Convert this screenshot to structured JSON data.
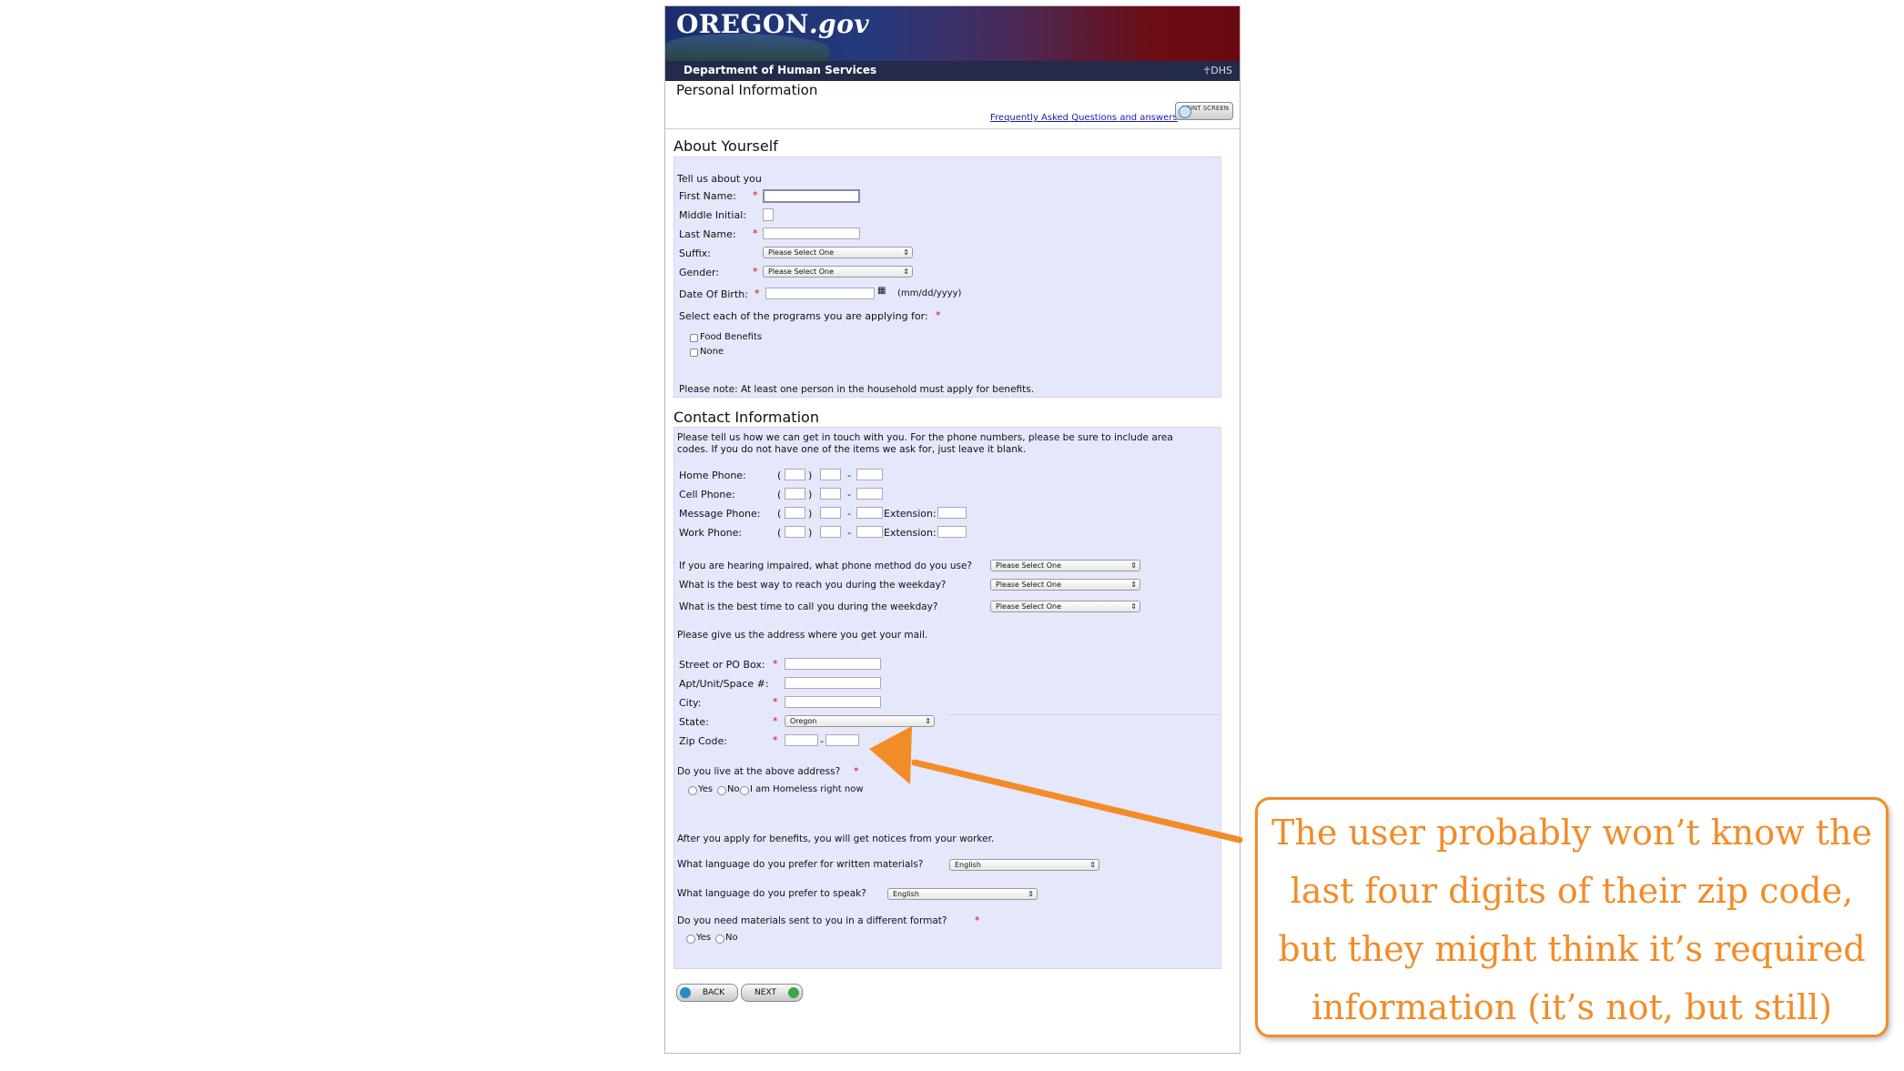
{
  "header": {
    "logo_main": "OREGON",
    "logo_suffix": ".gov",
    "department": "Department of Human Services",
    "dept_short": "DHS",
    "page_title": "Personal Information",
    "faq_link": "Frequently Asked Questions and answers",
    "print_label": "PRINT SCREEN"
  },
  "about": {
    "section_title": "About Yourself",
    "intro": "Tell us about you",
    "first_name_label": "First Name:",
    "middle_initial_label": "Middle Initial:",
    "last_name_label": "Last Name:",
    "suffix_label": "Suffix:",
    "suffix_value": "Please Select One",
    "gender_label": "Gender:",
    "gender_value": "Please Select One",
    "dob_label": "Date Of Birth:",
    "dob_format": "(mm/dd/yyyy)",
    "programs_prompt": "Select each of the programs you are applying for:",
    "programs": [
      "Food Benefits",
      "None"
    ],
    "note": "Please note: At least one person in the household must apply for benefits."
  },
  "contact": {
    "section_title": "Contact Information",
    "intro_line1": "Please tell us how we can get in touch with you. For the phone numbers, please be sure to include area",
    "intro_line2": "codes. If you do not have one of the items we ask for, just leave it blank.",
    "home_phone_label": "Home Phone:",
    "cell_phone_label": "Cell Phone:",
    "message_phone_label": "Message Phone:",
    "work_phone_label": "Work Phone:",
    "extension_label": "Extension:",
    "paren_open": "(",
    "paren_close": ")",
    "dash": "-",
    "hearing_question": "If you are hearing impaired, what phone method do you use?",
    "reach_question": "What is the best way to reach you during the weekday?",
    "time_question": "What is the best time to call you during the weekday?",
    "select_placeholder": "Please Select One",
    "address_prompt": "Please give us the address where you get your mail.",
    "street_label": "Street or PO Box:",
    "apt_label": "Apt/Unit/Space #:",
    "city_label": "City:",
    "state_label": "State:",
    "state_value": "Oregon",
    "zip_label": "Zip Code:",
    "live_question": "Do you live at the above address?",
    "live_options": [
      "Yes",
      "No",
      "I am Homeless right now"
    ],
    "notices_text": "After you apply for benefits, you will get notices from your worker.",
    "written_lang_question": "What language do you prefer for written materials?",
    "written_lang_value": "English",
    "spoken_lang_question": "What language do you prefer to speak?",
    "spoken_lang_value": "English",
    "format_question": "Do you need materials sent to you in a different format?",
    "format_options": [
      "Yes",
      "No"
    ],
    "required_mark": "*"
  },
  "nav": {
    "back_label": "BACK",
    "next_label": "NEXT"
  },
  "callout": {
    "line1": "The user probably won’t know the",
    "line2": "last four digits of their zip code,",
    "line3": "but they might think it’s required",
    "line4": "information (it’s not, but still)"
  },
  "colors": {
    "accent": "#f28c28",
    "panel": "#e5e8fb",
    "required": "#dd0000",
    "link": "#1a1aa6"
  }
}
